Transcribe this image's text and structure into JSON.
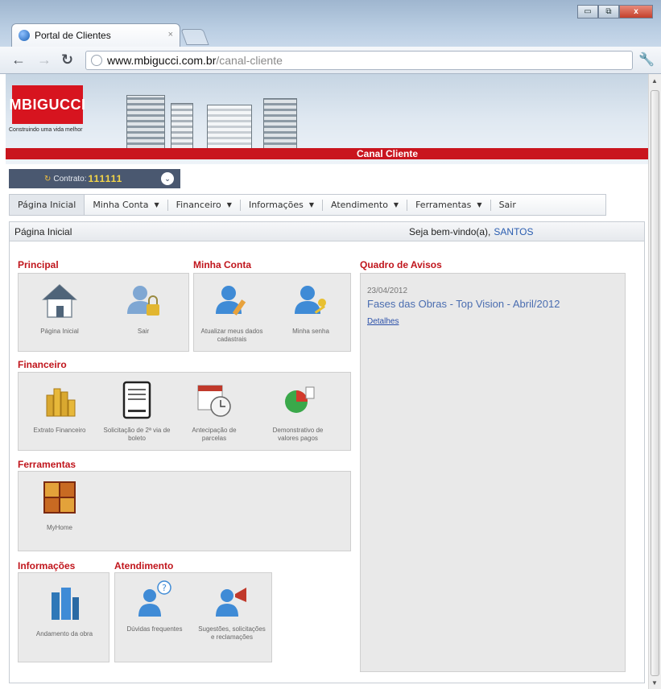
{
  "browser": {
    "tab_title": "Portal de Clientes",
    "tab_close": "×",
    "url_host": "www.mbigucci.com.br",
    "url_path": "/canal-cliente",
    "window_buttons": {
      "minimize": "▭",
      "maximize": "⧉",
      "close": "x"
    }
  },
  "banner": {
    "logo_text": "MBIGUCCI",
    "tagline": "Construindo uma vida melhor",
    "canal_label": "Canal Cliente"
  },
  "contract": {
    "label": "Contrato:",
    "value": "111111",
    "icon": "refresh-icon"
  },
  "menu": {
    "items": [
      {
        "label": "Página Inicial",
        "dropdown": false
      },
      {
        "label": "Minha Conta",
        "dropdown": true
      },
      {
        "label": "Financeiro",
        "dropdown": true
      },
      {
        "label": "Informações",
        "dropdown": true
      },
      {
        "label": "Atendimento",
        "dropdown": true
      },
      {
        "label": "Ferramentas",
        "dropdown": true
      },
      {
        "label": "Sair",
        "dropdown": false
      }
    ]
  },
  "panel": {
    "title": "Página Inicial",
    "welcome": "Seja bem-vindo(a),",
    "user": "SANTOS"
  },
  "sections": {
    "principal": {
      "title": "Principal",
      "items": [
        {
          "label": "Página Inicial",
          "icon": "house-icon"
        },
        {
          "label": "Sair",
          "icon": "user-lock-icon"
        }
      ]
    },
    "minha_conta": {
      "title": "Minha Conta",
      "items": [
        {
          "label": "Atualizar meus dados cadastrais",
          "icon": "user-edit-icon"
        },
        {
          "label": "Minha senha",
          "icon": "user-key-icon"
        }
      ]
    },
    "financeiro": {
      "title": "Financeiro",
      "items": [
        {
          "label": "Extrato Financeiro",
          "icon": "coins-icon"
        },
        {
          "label": "Solicitação de 2ª via de boleto",
          "icon": "document-icon"
        },
        {
          "label": "Antecipação de parcelas",
          "icon": "calendar-clock-icon"
        },
        {
          "label": "Demonstrativo de valores pagos",
          "icon": "pie-chart-icon"
        }
      ]
    },
    "ferramentas": {
      "title": "Ferramentas",
      "items": [
        {
          "label": "MyHome",
          "icon": "myhome-icon"
        }
      ]
    },
    "informacoes": {
      "title": "Informações",
      "items": [
        {
          "label": "Andamento da obra",
          "icon": "building-icon"
        }
      ]
    },
    "atendimento": {
      "title": "Atendimento",
      "items": [
        {
          "label": "Dúvidas frequentes",
          "icon": "user-question-icon"
        },
        {
          "label": "Sugestões, solicitações e reclamações",
          "icon": "user-megaphone-icon"
        }
      ]
    }
  },
  "notices": {
    "title": "Quadro de Avisos",
    "items": [
      {
        "date": "23/04/2012",
        "title": "Fases das Obras - Top Vision - Abril/2012",
        "link": "Detalhes"
      }
    ]
  },
  "colors": {
    "brand_red": "#c9151e",
    "section_red": "#c0151c",
    "link_blue": "#2a5db0",
    "contract_bg": "#4a5870",
    "contract_value": "#f3d548"
  }
}
